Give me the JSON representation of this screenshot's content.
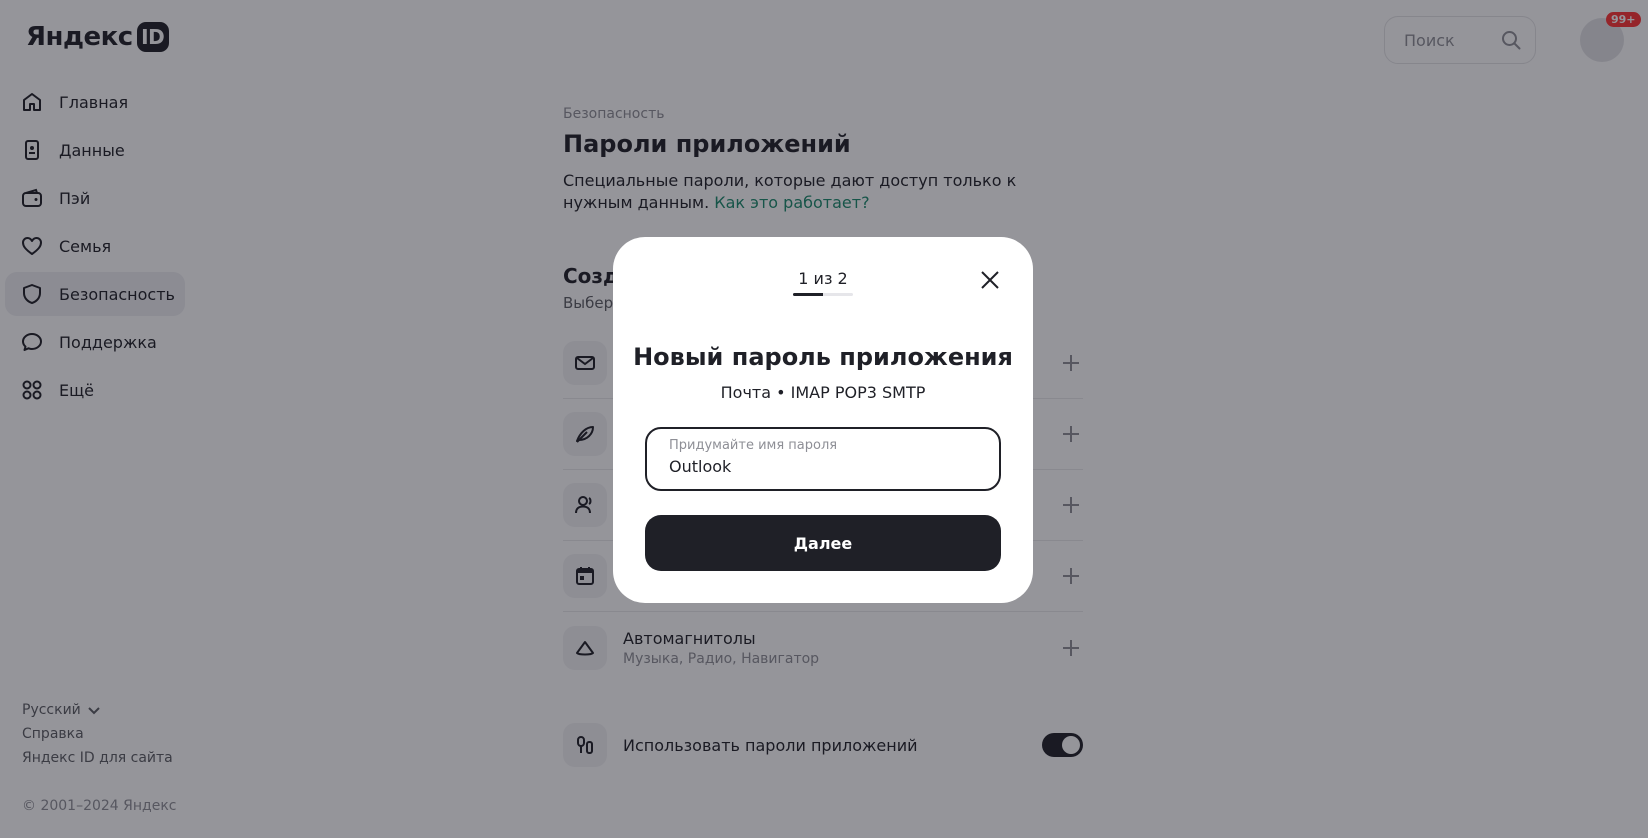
{
  "header": {
    "logo_text": "Яндекс",
    "logo_badge": "ID",
    "search_placeholder": "Поиск",
    "notifications": "99+"
  },
  "sidebar": {
    "items": [
      {
        "label": "Главная",
        "icon": "home-icon"
      },
      {
        "label": "Данные",
        "icon": "id-card-icon"
      },
      {
        "label": "Пэй",
        "icon": "wallet-icon"
      },
      {
        "label": "Семья",
        "icon": "heart-icon"
      },
      {
        "label": "Безопасность",
        "icon": "shield-icon",
        "active": true
      },
      {
        "label": "Поддержка",
        "icon": "chat-icon"
      },
      {
        "label": "Ещё",
        "icon": "grid-icon"
      }
    ],
    "footer": {
      "language": "Русский",
      "help": "Справка",
      "for_site": "Яндекс ID для сайта",
      "copyright": "© 2001–2024 Яндекс"
    }
  },
  "main": {
    "breadcrumb": "Безопасность",
    "title": "Пароли приложений",
    "description": "Специальные пароли, которые дают доступ только к нужным данным.",
    "how_link": "Как это работает?",
    "section_title": "Созда",
    "section_sub": "Выбер",
    "rows": [
      {
        "icon": "mail-icon",
        "title": "",
        "sub": ""
      },
      {
        "icon": "feather-icon",
        "title": "",
        "sub": ""
      },
      {
        "icon": "contacts-icon",
        "title": "",
        "sub": ""
      },
      {
        "icon": "calendar-icon",
        "title": "",
        "sub": ""
      },
      {
        "icon": "car-icon",
        "title": "Автомагнитолы",
        "sub": "Музыка, Радио, Навигатор"
      }
    ],
    "toggle_label": "Использовать пароли приложений",
    "toggle_on": true
  },
  "modal": {
    "step": "1 из 2",
    "progress": 0.5,
    "title": "Новый пароль приложения",
    "subtitle": "Почта • IMAP POP3 SMTP",
    "field_label": "Придумайте имя пароля",
    "field_value": "Outlook",
    "next_label": "Далее"
  },
  "colors": {
    "primary": "#1f2027",
    "link": "#1a8a6c",
    "overlay": "#14142073",
    "badge": "#ff3333"
  }
}
